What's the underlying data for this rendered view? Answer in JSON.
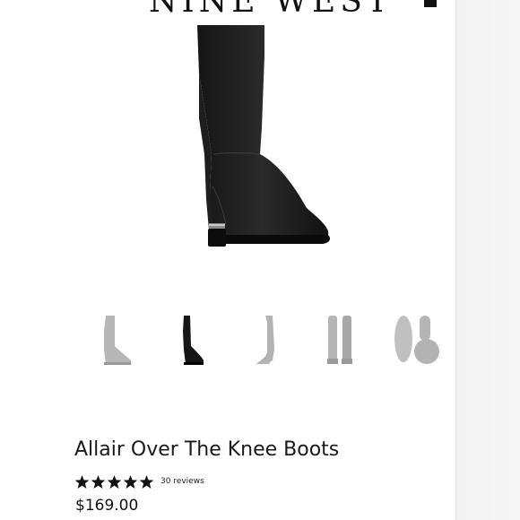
{
  "header": {
    "brand": "NINE WEST"
  },
  "gallery": {
    "selected_index": 1,
    "thumbnails": [
      {
        "name": "side-view"
      },
      {
        "name": "front-view"
      },
      {
        "name": "back-view"
      },
      {
        "name": "pair-view"
      },
      {
        "name": "sole-view"
      }
    ]
  },
  "product": {
    "title": "Allair Over The Knee Boots",
    "rating": 5,
    "reviews_label": "30 reviews",
    "price": "$169.00"
  },
  "colors": {
    "text": "#111111",
    "thumb_inactive": "#b5b5b5",
    "edge": "#f3f3f4"
  }
}
